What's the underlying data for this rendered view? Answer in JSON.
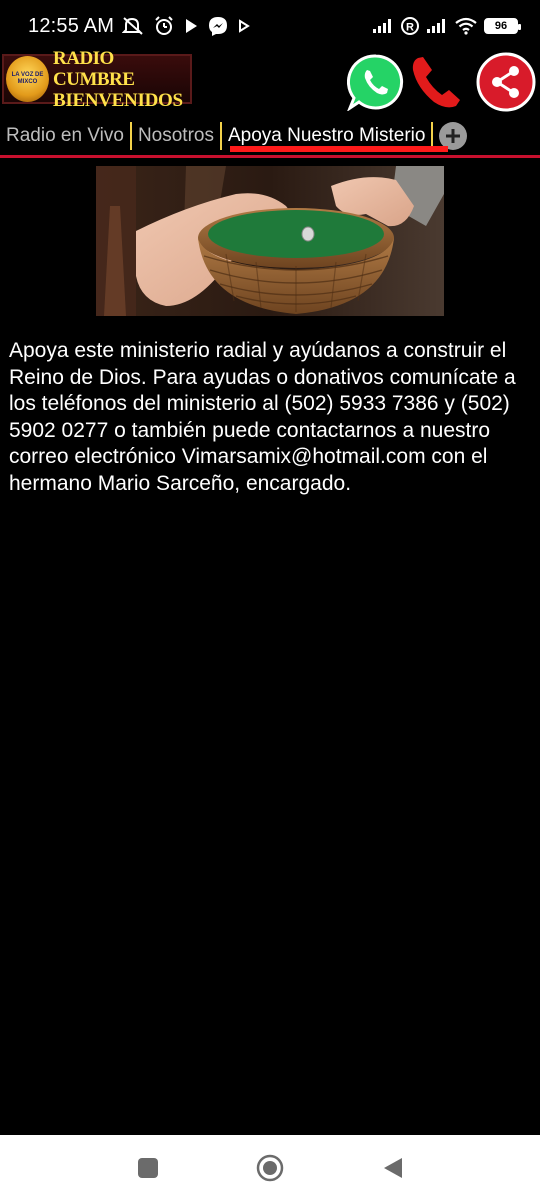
{
  "status_bar": {
    "time": "12:55 AM",
    "battery": "96",
    "icons": [
      "mute-icon",
      "alarm-icon",
      "play-icon",
      "messenger-icon",
      "play-small-icon",
      "signal-icon",
      "roaming-icon",
      "signal-icon",
      "wifi-icon",
      "battery-icon"
    ]
  },
  "header": {
    "logo_line1": "RADIO CUMBRE",
    "logo_line2": "BIENVENIDOS",
    "logo_badge_text": "LA VOZ DE MIXCO",
    "whatsapp_icon": "whatsapp-icon",
    "phone_icon": "phone-icon",
    "share_icon": "share-icon",
    "colors": {
      "logo_text": "#ffe14a",
      "whatsapp": "#25d366",
      "phone": "#e21b1b",
      "share": "#d81b2a"
    }
  },
  "tabs": {
    "items": [
      {
        "label": "Radio en Vivo"
      },
      {
        "label": "Nosotros"
      },
      {
        "label": "Apoya Nuestro Misterio"
      }
    ],
    "active_index": 2,
    "add_icon": "plus-icon",
    "colors": {
      "indicator": "#ff1a1a",
      "separator": "#f3d24a"
    }
  },
  "content": {
    "image_subject": "hands placing coin into wicker offering basket",
    "paragraph": "Apoya este ministerio radial y ayúdanos a construir el Reino de Dios. Para ayudas o donativos comunícate a los teléfonos del ministerio al (502) 5933 7386 y (502) 5902 0277 o también puede contactarnos a nuestro correo electrónico Vimarsamix@hotmail.com con el hermano Mario Sarceño, encargado."
  },
  "nav_bar": {
    "recents_icon": "square-icon",
    "home_icon": "circle-icon",
    "back_icon": "triangle-back-icon"
  }
}
